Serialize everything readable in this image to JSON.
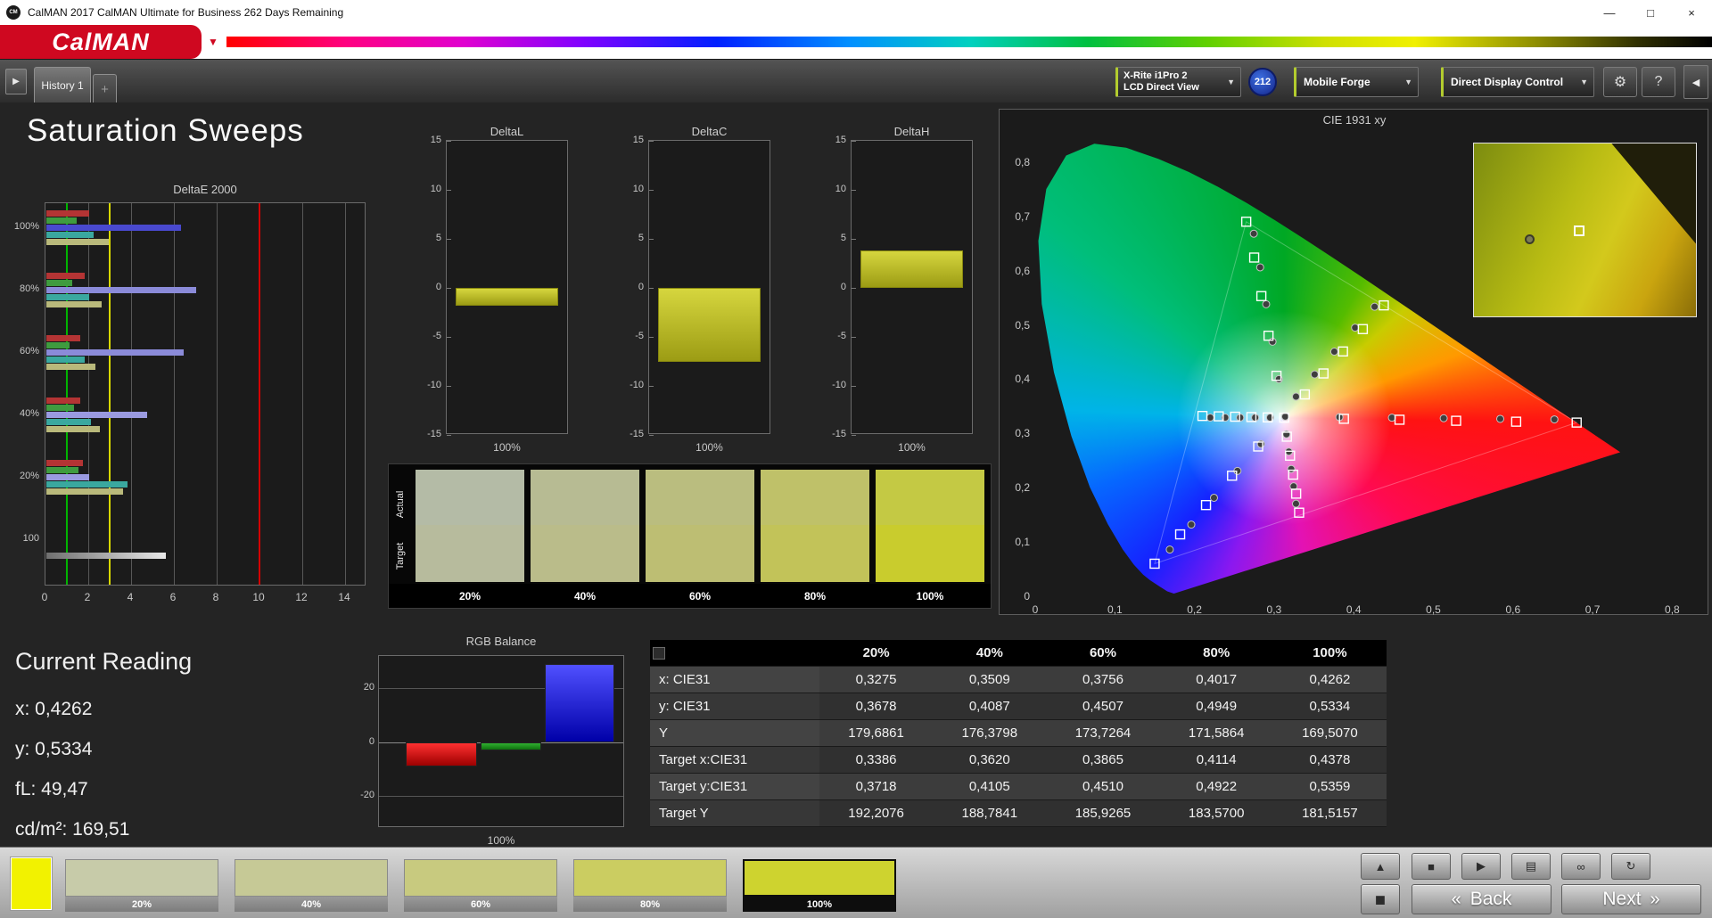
{
  "window": {
    "title": "CalMAN 2017 CalMAN Ultimate for Business 262 Days Remaining"
  },
  "logo": {
    "text": "CalMAN"
  },
  "icons": {
    "app_monogram": "CM",
    "expand_left_panel": "▶",
    "collapse_right_panel": "◀",
    "settings": "⚙",
    "help": "?",
    "caret_down": "▼",
    "minimize": "—",
    "maximize": "□",
    "close": "×",
    "collapse_up": "▲",
    "stop": "■",
    "play": "▶",
    "save": "▤",
    "continuous": "∞",
    "refresh": "↻",
    "panel": "◼",
    "back_chevron": "«",
    "next_chevron": "»",
    "add_tab": "+"
  },
  "tabbar": {
    "history_tab": "History 1",
    "meter_line1": "X-Rite i1Pro 2",
    "meter_line2": "LCD Direct View",
    "reading_count": "212",
    "source": "Mobile Forge",
    "display_control": "Direct Display Control"
  },
  "page_title": "Saturation Sweeps",
  "current_reading": {
    "title": "Current Reading",
    "lines": [
      "x: 0,4262",
      "y: 0,5334",
      "fL: 49,47",
      "cd/m²: 169,51"
    ]
  },
  "bottom": {
    "patch_color": "#f2f200",
    "swatches": [
      {
        "label": "20%",
        "color": "#c7cba9",
        "selected": false
      },
      {
        "label": "40%",
        "color": "#c6c996",
        "selected": false
      },
      {
        "label": "60%",
        "color": "#c8ca7f",
        "selected": false
      },
      {
        "label": "80%",
        "color": "#cbcd61",
        "selected": false
      },
      {
        "label": "100%",
        "color": "#ced32f",
        "selected": true
      }
    ],
    "back_label": "Back",
    "next_label": "Next"
  },
  "chart_data": [
    {
      "id": "deltae2000",
      "type": "bar",
      "orientation": "horizontal",
      "title": "DeltaE 2000",
      "xlim": [
        0,
        15
      ],
      "x_ticks": [
        0,
        2,
        4,
        6,
        8,
        10,
        12,
        14
      ],
      "reference_lines": [
        {
          "value": 1.0,
          "color": "#00b400"
        },
        {
          "value": 3.0,
          "color": "#d8d800"
        },
        {
          "value": 10.0,
          "color": "#d40000"
        }
      ],
      "groups": [
        {
          "label": "100%",
          "bars": [
            {
              "color": "#b43434",
              "value": 2.0
            },
            {
              "color": "#3f9b3f",
              "value": 1.4
            },
            {
              "color": "#4949cf",
              "value": 6.3
            },
            {
              "color": "#3aa89f",
              "value": 2.2
            },
            {
              "color": "#b9b97b",
              "value": 2.9
            }
          ]
        },
        {
          "label": "80%",
          "bars": [
            {
              "color": "#b43434",
              "value": 1.8
            },
            {
              "color": "#3f9b3f",
              "value": 1.2
            },
            {
              "color": "#8b8bd9",
              "value": 7.0
            },
            {
              "color": "#3aa89f",
              "value": 2.0
            },
            {
              "color": "#b9b97b",
              "value": 2.6
            }
          ]
        },
        {
          "label": "60%",
          "bars": [
            {
              "color": "#b43434",
              "value": 1.6
            },
            {
              "color": "#3f9b3f",
              "value": 1.1
            },
            {
              "color": "#8b8bd9",
              "value": 6.4
            },
            {
              "color": "#3aa89f",
              "value": 1.8
            },
            {
              "color": "#b9b97b",
              "value": 2.3
            }
          ]
        },
        {
          "label": "40%",
          "bars": [
            {
              "color": "#b43434",
              "value": 1.6
            },
            {
              "color": "#3f9b3f",
              "value": 1.3
            },
            {
              "color": "#9a9ae0",
              "value": 4.7
            },
            {
              "color": "#3aa89f",
              "value": 2.1
            },
            {
              "color": "#b9b97b",
              "value": 2.5
            }
          ]
        },
        {
          "label": "20%",
          "bars": [
            {
              "color": "#b43434",
              "value": 1.7
            },
            {
              "color": "#3f9b3f",
              "value": 1.5
            },
            {
              "color": "#9a9ae0",
              "value": 2.0
            },
            {
              "color": "#3aa89f",
              "value": 3.8
            },
            {
              "color": "#b9b97b",
              "value": 3.6
            }
          ]
        },
        {
          "label": "100",
          "bars": [
            {
              "color": "#6f6f6f",
              "color2": "#e8e8e8",
              "value": 5.6
            }
          ]
        }
      ]
    },
    {
      "id": "deltaL",
      "type": "bar",
      "title": "DeltaL",
      "ylim": [
        -15,
        15
      ],
      "y_ticks": [
        15,
        10,
        5,
        0,
        -5,
        -10,
        -15
      ],
      "category": "100%",
      "value": -1.8,
      "bar_color": "#d6d63e",
      "bar_color2": "#9c9c14"
    },
    {
      "id": "deltaC",
      "type": "bar",
      "title": "DeltaC",
      "ylim": [
        -15,
        15
      ],
      "y_ticks": [
        15,
        10,
        5,
        0,
        -5,
        -10,
        -15
      ],
      "category": "100%",
      "value": -7.5,
      "bar_color": "#d6d63e",
      "bar_color2": "#9c9c14"
    },
    {
      "id": "deltaH",
      "type": "bar",
      "title": "DeltaH",
      "ylim": [
        -15,
        15
      ],
      "y_ticks": [
        15,
        10,
        5,
        0,
        -5,
        -10,
        -15
      ],
      "category": "100%",
      "value": 3.8,
      "bar_color": "#d6d63e",
      "bar_color2": "#9c9c14"
    },
    {
      "id": "rgb_balance",
      "type": "bar",
      "title": "RGB Balance",
      "ylim": [
        -32,
        32
      ],
      "y_ticks": [
        20,
        0,
        -20
      ],
      "category": "100%",
      "series": [
        {
          "name": "Red",
          "value": -9,
          "color": "#ff3030",
          "color2": "#9c0000"
        },
        {
          "name": "Green",
          "value": -3,
          "color": "#30b030",
          "color2": "#0e700e"
        },
        {
          "name": "Blue",
          "value": 29,
          "color": "#5050ff",
          "color2": "#0000a8"
        }
      ]
    },
    {
      "id": "cie_diagram",
      "type": "scatter",
      "title": "CIE 1931 xy",
      "xlim": [
        0,
        0.8
      ],
      "ylim": [
        0,
        0.8
      ],
      "x_ticks": [
        {
          "v": 0,
          "label": "0"
        },
        {
          "v": 0.1,
          "label": "0,1"
        },
        {
          "v": 0.2,
          "label": "0,2"
        },
        {
          "v": 0.3,
          "label": "0,3"
        },
        {
          "v": 0.4,
          "label": "0,4"
        },
        {
          "v": 0.5,
          "label": "0,5"
        },
        {
          "v": 0.6,
          "label": "0,6"
        },
        {
          "v": 0.7,
          "label": "0,7"
        },
        {
          "v": 0.8,
          "label": "0,8"
        }
      ],
      "y_ticks": [
        {
          "v": 0,
          "label": "0"
        },
        {
          "v": 0.1,
          "label": "0,1"
        },
        {
          "v": 0.2,
          "label": "0,2"
        },
        {
          "v": 0.3,
          "label": "0,3"
        },
        {
          "v": 0.4,
          "label": "0,4"
        },
        {
          "v": 0.5,
          "label": "0,5"
        },
        {
          "v": 0.6,
          "label": "0,6"
        },
        {
          "v": 0.7,
          "label": "0,7"
        },
        {
          "v": 0.8,
          "label": "0,8"
        }
      ],
      "white_point": {
        "target": [
          0.3127,
          0.329
        ],
        "measured": [
          0.314,
          0.331
        ]
      },
      "gamut_triangle": [
        [
          0.265,
          0.69
        ],
        [
          0.68,
          0.32
        ],
        [
          0.15,
          0.06
        ]
      ],
      "sweeps": [
        {
          "name": "red",
          "targets": [
            [
              0.3877,
              0.3269
            ],
            [
              0.4575,
              0.3252
            ],
            [
              0.5286,
              0.3233
            ],
            [
              0.604,
              0.3216
            ],
            [
              0.68,
              0.32
            ]
          ],
          "measured": [
            [
              0.382,
              0.33
            ],
            [
              0.448,
              0.329
            ],
            [
              0.513,
              0.328
            ],
            [
              0.584,
              0.3268
            ],
            [
              0.652,
              0.3258
            ]
          ]
        },
        {
          "name": "green",
          "targets": [
            [
              0.303,
              0.4062
            ],
            [
              0.293,
              0.48
            ],
            [
              0.284,
              0.553
            ],
            [
              0.275,
              0.624
            ],
            [
              0.265,
              0.69
            ]
          ],
          "measured": [
            [
              0.306,
              0.4
            ],
            [
              0.298,
              0.469
            ],
            [
              0.29,
              0.538
            ],
            [
              0.2825,
              0.606
            ],
            [
              0.2745,
              0.668
            ]
          ]
        },
        {
          "name": "blue",
          "targets": [
            [
              0.28,
              0.2759
            ],
            [
              0.2472,
              0.2221
            ],
            [
              0.2145,
              0.168
            ],
            [
              0.182,
              0.114
            ],
            [
              0.15,
              0.06
            ]
          ],
          "measured": [
            [
              0.2835,
              0.2805
            ],
            [
              0.254,
              0.231
            ],
            [
              0.2245,
              0.1815
            ],
            [
              0.196,
              0.132
            ],
            [
              0.169,
              0.086
            ]
          ]
        },
        {
          "name": "magenta",
          "targets": [
            [
              0.316,
              0.294
            ],
            [
              0.32,
              0.259
            ],
            [
              0.3239,
              0.224
            ],
            [
              0.3277,
              0.189
            ],
            [
              0.3314,
              0.154
            ]
          ],
          "measured": [
            [
              0.3155,
              0.2985
            ],
            [
              0.3185,
              0.2665
            ],
            [
              0.3215,
              0.2345
            ],
            [
              0.3245,
              0.2025
            ],
            [
              0.3275,
              0.1705
            ]
          ]
        },
        {
          "name": "cyan",
          "targets": [
            [
              0.292,
              0.3295
            ],
            [
              0.2715,
              0.3302
            ],
            [
              0.251,
              0.3308
            ],
            [
              0.2305,
              0.3315
            ],
            [
              0.21,
              0.3322
            ]
          ],
          "measured": [
            [
              0.295,
              0.3292
            ],
            [
              0.2762,
              0.3292
            ],
            [
              0.2574,
              0.3292
            ],
            [
              0.2386,
              0.3292
            ],
            [
              0.2198,
              0.3292
            ]
          ]
        },
        {
          "name": "yellow",
          "targets": [
            [
              0.3386,
              0.3718
            ],
            [
              0.362,
              0.4105
            ],
            [
              0.3865,
              0.451
            ],
            [
              0.4114,
              0.4922
            ],
            [
              0.4378,
              0.5359
            ]
          ],
          "measured": [
            [
              0.3275,
              0.3678
            ],
            [
              0.3509,
              0.4087
            ],
            [
              0.3756,
              0.4507
            ],
            [
              0.4017,
              0.4949
            ],
            [
              0.4262,
              0.5334
            ]
          ]
        }
      ]
    },
    {
      "id": "swatch_strip",
      "type": "swatches",
      "row_labels": [
        "Actual",
        "Target"
      ],
      "columns": [
        "20%",
        "40%",
        "60%",
        "80%",
        "100%"
      ],
      "actual_colors": [
        "#b4bba6",
        "#b7bb93",
        "#babd7f",
        "#bfc169",
        "#c4c944"
      ],
      "target_colors": [
        "#b7bb9d",
        "#babc8a",
        "#bdbe73",
        "#c2c359",
        "#c9cc2d"
      ]
    },
    {
      "id": "results_table",
      "type": "table",
      "columns": [
        "20%",
        "40%",
        "60%",
        "80%",
        "100%"
      ],
      "rows": [
        {
          "label": "x: CIE31",
          "values": [
            "0,3275",
            "0,3509",
            "0,3756",
            "0,4017",
            "0,4262"
          ]
        },
        {
          "label": "y: CIE31",
          "values": [
            "0,3678",
            "0,4087",
            "0,4507",
            "0,4949",
            "0,5334"
          ]
        },
        {
          "label": "Y",
          "values": [
            "179,6861",
            "176,3798",
            "173,7264",
            "171,5864",
            "169,5070"
          ]
        },
        {
          "label": "Target x:CIE31",
          "values": [
            "0,3386",
            "0,3620",
            "0,3865",
            "0,4114",
            "0,4378"
          ]
        },
        {
          "label": "Target y:CIE31",
          "values": [
            "0,3718",
            "0,4105",
            "0,4510",
            "0,4922",
            "0,5359"
          ]
        },
        {
          "label": "Target Y",
          "values": [
            "192,2076",
            "188,7841",
            "185,9265",
            "183,5700",
            "181,5157"
          ]
        }
      ]
    }
  ]
}
